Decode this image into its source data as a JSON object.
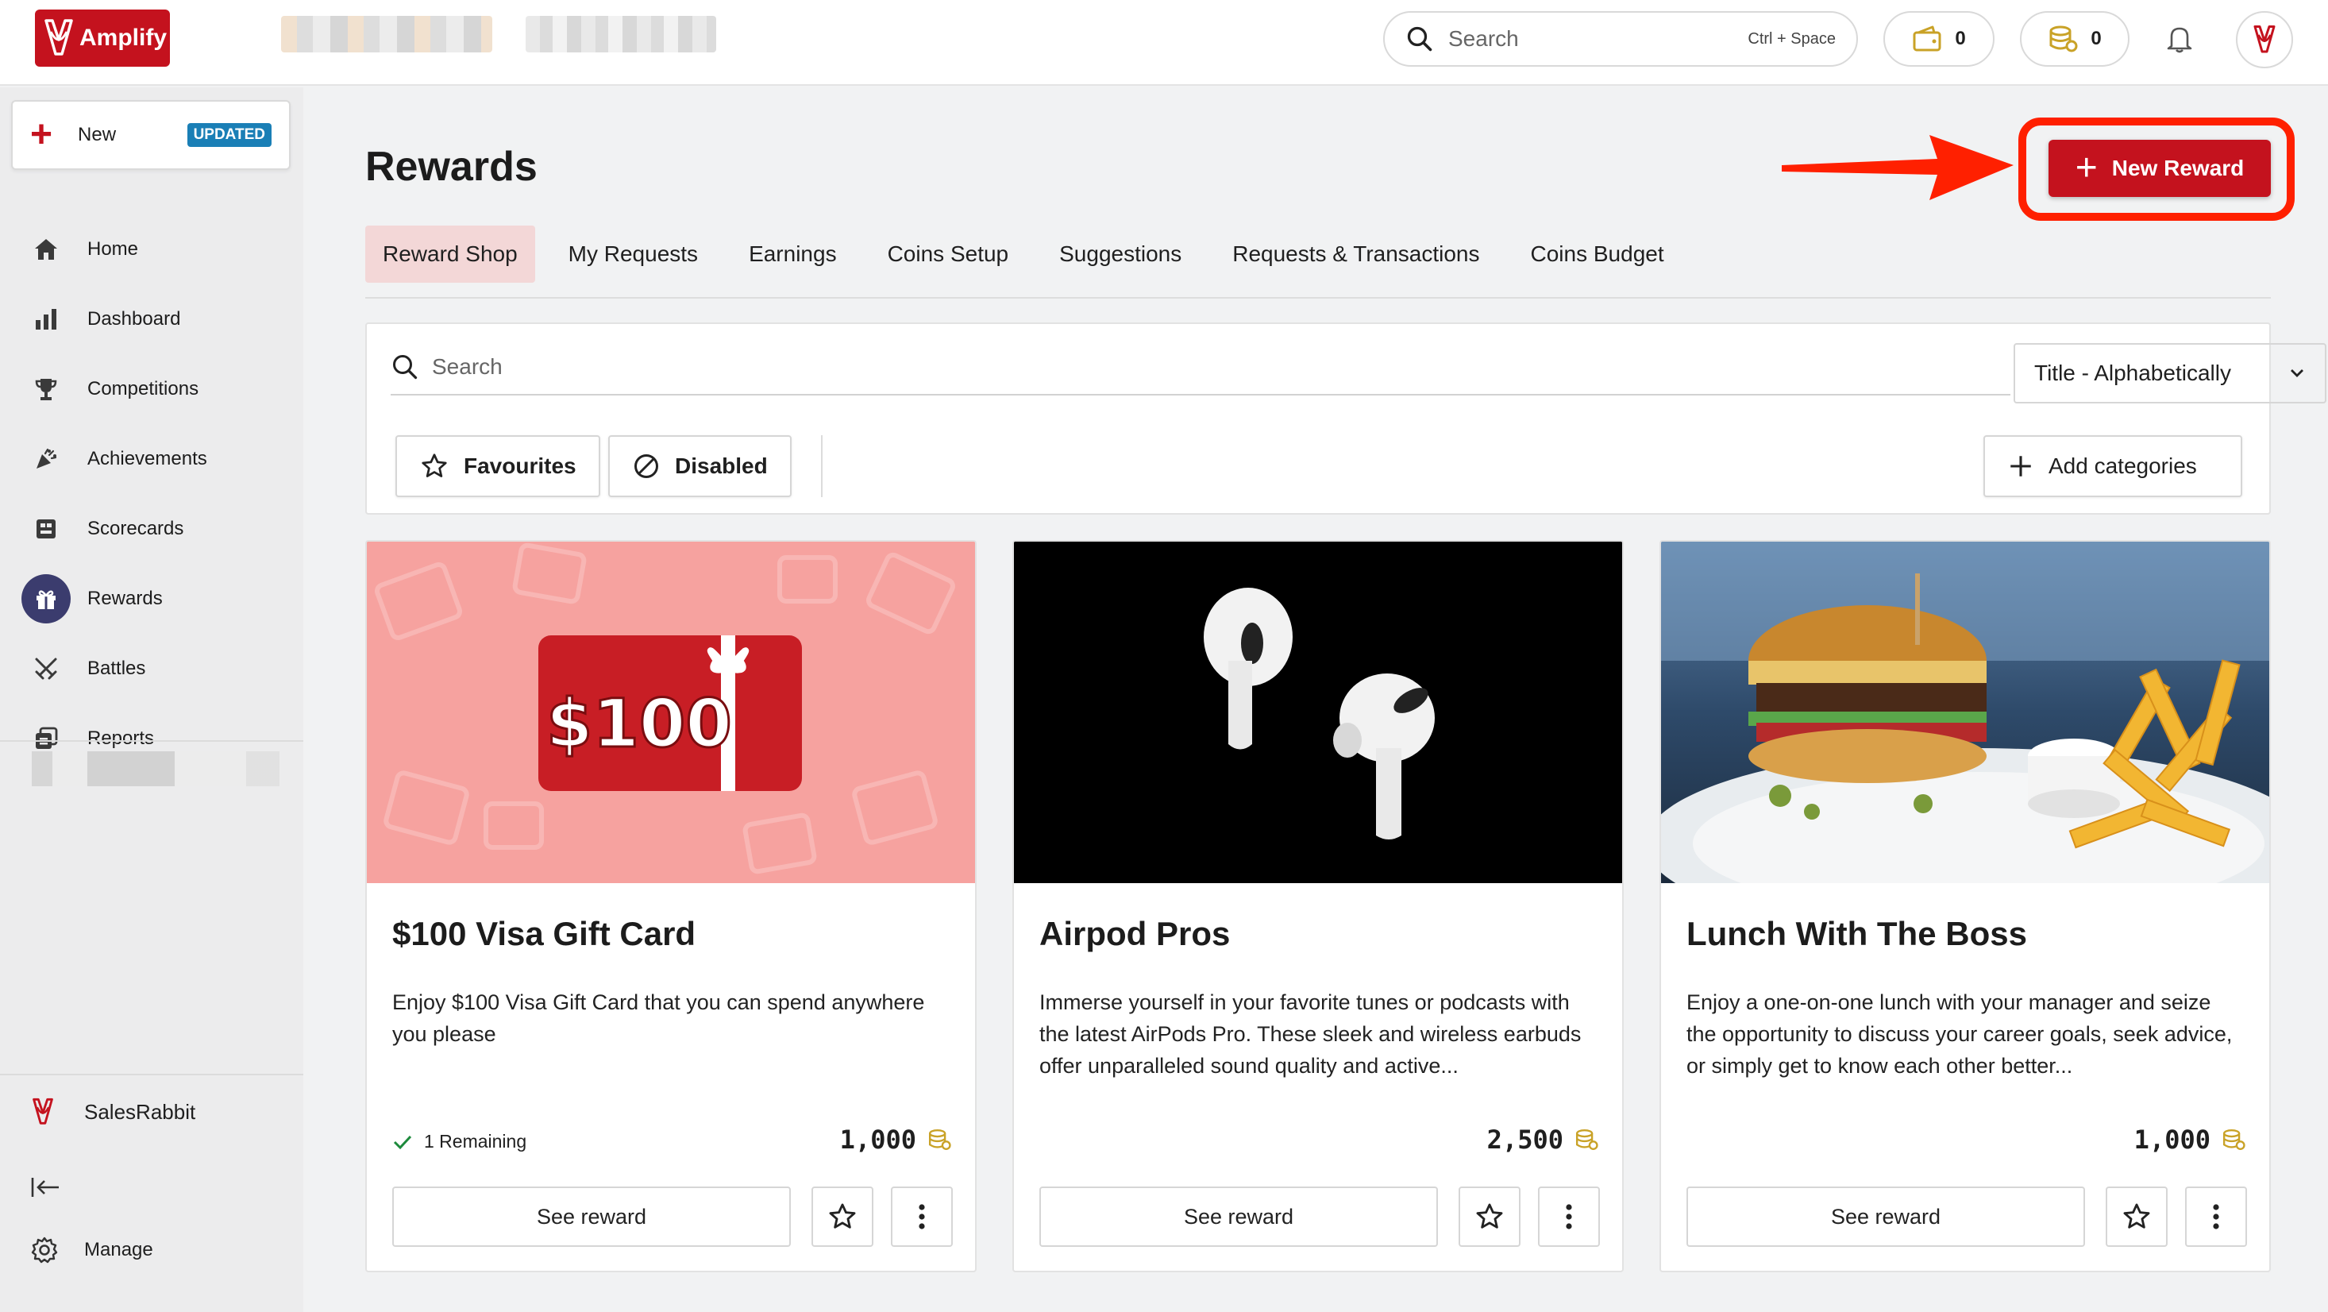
{
  "app": {
    "name": "Amplify"
  },
  "topbar": {
    "search_placeholder": "Search",
    "search_shortcut": "Ctrl + Space",
    "wallet_count": "0",
    "coins_count": "0"
  },
  "sidebar": {
    "new_label": "New",
    "new_badge": "UPDATED",
    "items": [
      {
        "label": "Home",
        "icon": "home-icon"
      },
      {
        "label": "Dashboard",
        "icon": "bar-chart-icon"
      },
      {
        "label": "Competitions",
        "icon": "trophy-icon"
      },
      {
        "label": "Achievements",
        "icon": "party-popper-icon"
      },
      {
        "label": "Scorecards",
        "icon": "scorecard-icon"
      },
      {
        "label": "Rewards",
        "icon": "gift-icon",
        "active": true
      },
      {
        "label": "Battles",
        "icon": "crossed-swords-icon"
      },
      {
        "label": "Reports",
        "icon": "reports-icon"
      }
    ],
    "brand_label": "SalesRabbit",
    "manage_label": "Manage"
  },
  "page": {
    "title": "Rewards",
    "new_reward_label": "New Reward",
    "tabs": [
      {
        "label": "Reward Shop",
        "active": true
      },
      {
        "label": "My Requests"
      },
      {
        "label": "Earnings"
      },
      {
        "label": "Coins Setup"
      },
      {
        "label": "Suggestions"
      },
      {
        "label": "Requests & Transactions"
      },
      {
        "label": "Coins Budget"
      }
    ]
  },
  "filters": {
    "search_placeholder": "Search",
    "sort_value": "Title - Alphabetically",
    "favourites_label": "Favourites",
    "disabled_label": "Disabled",
    "add_categories_label": "Add categories"
  },
  "rewards": [
    {
      "title": "$100 Visa Gift Card",
      "description": "Enjoy $100 Visa Gift Card that you can spend anywhere you please",
      "remaining": "1 Remaining",
      "cost": "1,000",
      "see_label": "See reward",
      "image_text": "$100"
    },
    {
      "title": "Airpod Pros",
      "description": "Immerse yourself in your favorite tunes or podcasts with the latest AirPods Pro. These sleek and wireless earbuds offer unparalleled sound quality and active...",
      "cost": "2,500",
      "see_label": "See reward"
    },
    {
      "title": "Lunch With The Boss",
      "description": "Enjoy a one-on-one lunch with your manager and seize the opportunity to discuss your career goals, seek advice, or simply get to know each other better...",
      "cost": "1,000",
      "see_label": "See reward"
    }
  ],
  "colors": {
    "brand_red": "#c4121e",
    "active_tab_bg": "#f3d7d7",
    "active_nav_circle": "#3b3c6e",
    "badge_blue": "#1a7fb6",
    "coin_gold": "#c9a227",
    "annotation_red": "#ff2000"
  }
}
